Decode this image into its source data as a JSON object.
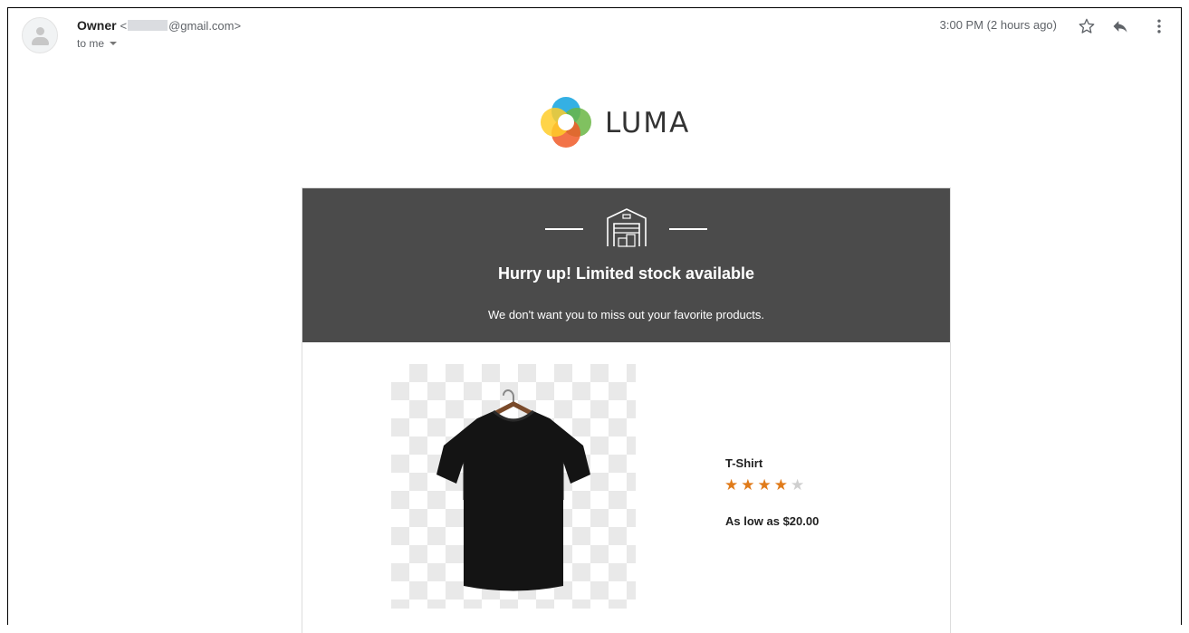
{
  "email": {
    "sender_name": "Owner",
    "sender_address_prefix": "<",
    "sender_address_suffix": "@gmail.com>",
    "recipient": "to me",
    "time": "3:00 PM (2 hours ago)"
  },
  "icons": {
    "avatar": "avatar-icon",
    "star": "star-icon",
    "reply": "reply-icon",
    "more": "more-vertical-icon",
    "warehouse": "warehouse-icon"
  },
  "logo": {
    "text": "LUMA"
  },
  "banner": {
    "title": "Hurry up! Limited stock available",
    "subtitle": "We don't want you to miss out your favorite products."
  },
  "product": {
    "name": "T-Shirt",
    "rating_stars": 4,
    "rating_max": 5,
    "price": "As low as $20.00"
  },
  "colors": {
    "banner_bg": "#4b4b4b",
    "star_filled": "#e07b1a",
    "star_empty": "#cfcfcf"
  }
}
